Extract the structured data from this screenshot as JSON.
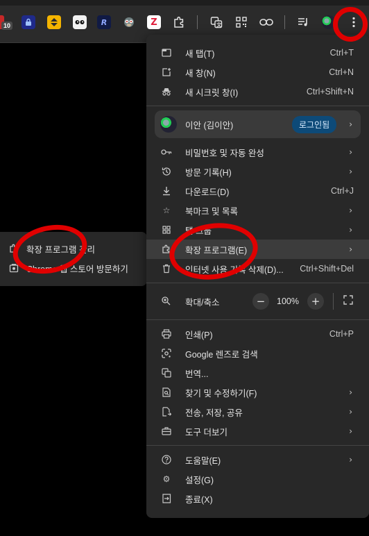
{
  "toolbar": {
    "extension_badge": "10",
    "icons": [
      "calendar-icon",
      "lock-icon",
      "updown-icon",
      "eyes-icon",
      "r-logo-icon",
      "monkey-icon",
      "z-icon",
      "puzzle-icon",
      "translate-icon",
      "qr-icon",
      "link-icon",
      "playlist-icon",
      "avatar",
      "more-vert-icon"
    ],
    "colors": {
      "extension_r": "#1a2a6b",
      "extension_yellow": "#f4b400",
      "extension_z": "#ffffff"
    }
  },
  "menu": {
    "items_top": [
      {
        "label": "새 탭(T)",
        "shortcut": "Ctrl+T",
        "icon": "new-tab-icon"
      },
      {
        "label": "새 창(N)",
        "shortcut": "Ctrl+N",
        "icon": "new-window-icon"
      },
      {
        "label": "새 시크릿 창(I)",
        "shortcut": "Ctrl+Shift+N",
        "icon": "incognito-icon"
      }
    ],
    "profile": {
      "name": "이안 (김이안)",
      "badge": "로그인됨"
    },
    "items_mid": [
      {
        "label": "비밀번호 및 자동 완성",
        "icon": "key-icon",
        "submenu": true
      },
      {
        "label": "방문 기록(H)",
        "icon": "history-icon",
        "submenu": true
      },
      {
        "label": "다운로드(D)",
        "shortcut": "Ctrl+J",
        "icon": "download-icon"
      },
      {
        "label": "북마크 및 목록",
        "icon": "star-icon",
        "submenu": true
      },
      {
        "label": "탭 그룹",
        "icon": "tab-groups-icon",
        "submenu": true
      },
      {
        "label": "확장 프로그램(E)",
        "icon": "extension-icon",
        "submenu": true
      },
      {
        "label": "인터넷 사용 기록 삭제(D)...",
        "shortcut": "Ctrl+Shift+Del",
        "icon": "trash-icon"
      }
    ],
    "zoom": {
      "label": "확대/축소",
      "minus": "−",
      "value": "100%",
      "plus": "+"
    },
    "items_tools": [
      {
        "label": "인쇄(P)",
        "shortcut": "Ctrl+P",
        "icon": "print-icon"
      },
      {
        "label": "Google 렌즈로 검색",
        "icon": "lens-icon"
      },
      {
        "label": "번역...",
        "icon": "translate-icon"
      },
      {
        "label": "찾기 및 수정하기(F)",
        "icon": "find-icon",
        "submenu": true
      },
      {
        "label": "전송, 저장, 공유",
        "icon": "share-icon",
        "submenu": true
      },
      {
        "label": "도구 더보기",
        "icon": "toolbox-icon",
        "submenu": true
      }
    ],
    "items_bottom": [
      {
        "label": "도움말(E)",
        "icon": "help-icon",
        "submenu": true
      },
      {
        "label": "설정(G)",
        "icon": "settings-icon"
      },
      {
        "label": "종료(X)",
        "icon": "exit-icon"
      }
    ]
  },
  "submenu": {
    "items": [
      {
        "label": "확장 프로그램 관리",
        "icon": "extension-icon"
      },
      {
        "label": "Chrome 웹 스토어 방문하기",
        "icon": "web-store-icon"
      }
    ]
  },
  "annotation_color": "#e00000"
}
